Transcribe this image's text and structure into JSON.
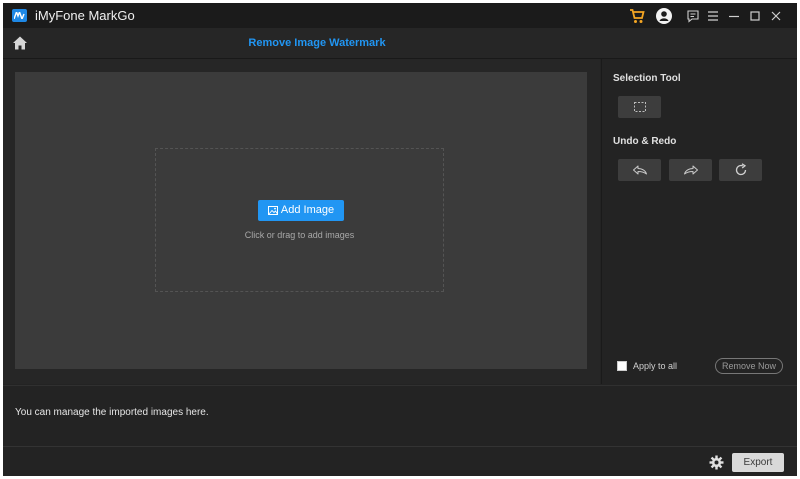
{
  "app": {
    "title": "iMyFone MarkGo",
    "logo_icon": "markgo-logo-icon"
  },
  "titlebar": {
    "icons": [
      "cart-icon",
      "account-icon",
      "feedback-icon",
      "menu-icon",
      "minimize-icon",
      "maximize-icon",
      "close-icon"
    ],
    "cart_color": "#f5a623"
  },
  "header": {
    "home_icon": "home-icon",
    "title": "Remove Image Watermark"
  },
  "canvas": {
    "add_button_label": "Add Image",
    "add_icon": "image-icon",
    "hint": "Click or drag to add images"
  },
  "panel": {
    "selection_heading": "Selection Tool",
    "selection_icon": "rectangle-select-icon",
    "undo_redo_heading": "Undo & Redo",
    "undo_icon": "undo-icon",
    "redo_icon": "redo-icon",
    "reset_icon": "refresh-icon",
    "apply_all_label": "Apply to all",
    "apply_all_checked": false,
    "remove_button_label": "Remove Now"
  },
  "bottom": {
    "manage_text": "You can manage the imported images here.",
    "settings_icon": "gear-icon",
    "export_label": "Export"
  },
  "colors": {
    "accent": "#2196f3",
    "background": "#232323",
    "canvas": "#3b3b3b"
  }
}
